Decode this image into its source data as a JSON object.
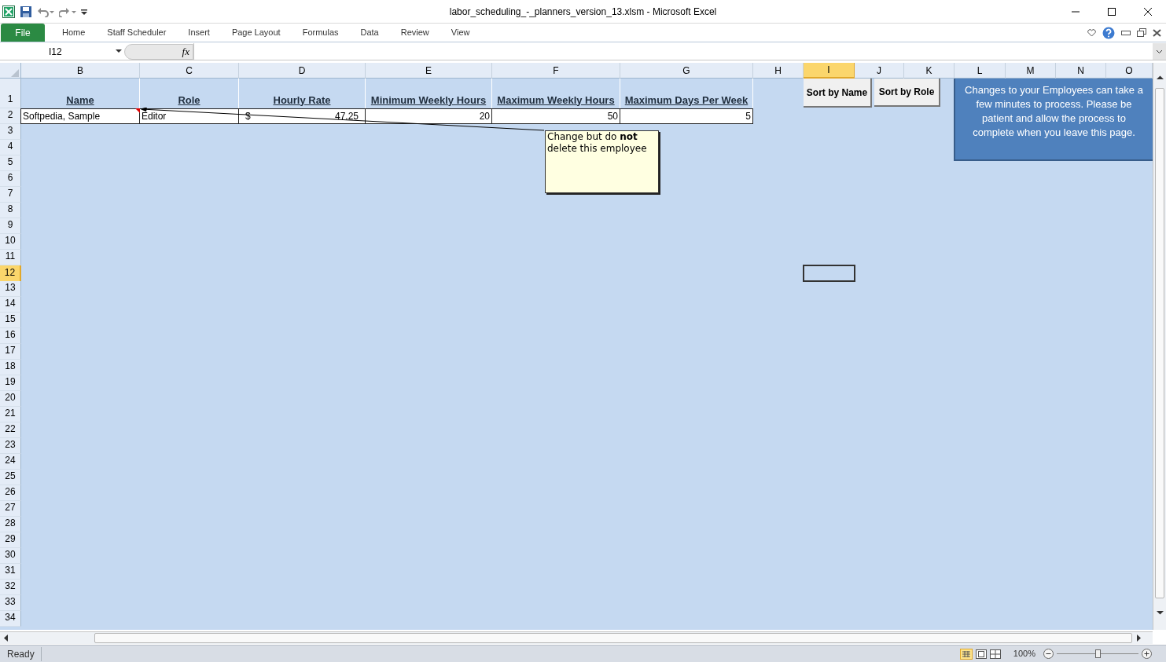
{
  "window": {
    "title": "labor_scheduling_-_planners_version_13.xlsm  -  Microsoft Excel"
  },
  "ribbon_tabs": [
    {
      "label": "File",
      "kind": "file",
      "selected": false
    },
    {
      "label": "Home",
      "kind": "tab",
      "selected": false
    },
    {
      "label": "Staff Scheduler",
      "kind": "tab",
      "selected": false
    },
    {
      "label": "Insert",
      "kind": "tab",
      "selected": false
    },
    {
      "label": "Page Layout",
      "kind": "tab",
      "selected": false
    },
    {
      "label": "Formulas",
      "kind": "tab",
      "selected": false
    },
    {
      "label": "Data",
      "kind": "tab",
      "selected": false
    },
    {
      "label": "Review",
      "kind": "tab",
      "selected": false
    },
    {
      "label": "View",
      "kind": "tab",
      "selected": false
    }
  ],
  "name_box": "I12",
  "function_button": "fx",
  "columns": [
    {
      "label": "B",
      "selected": false
    },
    {
      "label": "C",
      "selected": false
    },
    {
      "label": "D",
      "selected": false
    },
    {
      "label": "E",
      "selected": false
    },
    {
      "label": "F",
      "selected": false
    },
    {
      "label": "G",
      "selected": false
    },
    {
      "label": "H",
      "selected": false
    },
    {
      "label": "I",
      "selected": true
    },
    {
      "label": "J",
      "selected": false
    },
    {
      "label": "K",
      "selected": false
    },
    {
      "label": "L",
      "selected": false
    },
    {
      "label": "M",
      "selected": false
    },
    {
      "label": "N",
      "selected": false
    },
    {
      "label": "O",
      "selected": false
    }
  ],
  "rows": [
    {
      "label": "1",
      "selected": false
    },
    {
      "label": "2",
      "selected": false
    },
    {
      "label": "3",
      "selected": false
    },
    {
      "label": "4",
      "selected": false
    },
    {
      "label": "5",
      "selected": false
    },
    {
      "label": "6",
      "selected": false
    },
    {
      "label": "7",
      "selected": false
    },
    {
      "label": "8",
      "selected": false
    },
    {
      "label": "9",
      "selected": false
    },
    {
      "label": "10",
      "selected": false
    },
    {
      "label": "11",
      "selected": false
    },
    {
      "label": "12",
      "selected": true
    },
    {
      "label": "13",
      "selected": false
    },
    {
      "label": "14",
      "selected": false
    },
    {
      "label": "15",
      "selected": false
    },
    {
      "label": "16",
      "selected": false
    },
    {
      "label": "17",
      "selected": false
    },
    {
      "label": "18",
      "selected": false
    },
    {
      "label": "19",
      "selected": false
    },
    {
      "label": "20",
      "selected": false
    },
    {
      "label": "21",
      "selected": false
    },
    {
      "label": "22",
      "selected": false
    },
    {
      "label": "23",
      "selected": false
    },
    {
      "label": "24",
      "selected": false
    },
    {
      "label": "25",
      "selected": false
    },
    {
      "label": "26",
      "selected": false
    },
    {
      "label": "27",
      "selected": false
    },
    {
      "label": "28",
      "selected": false
    },
    {
      "label": "29",
      "selected": false
    },
    {
      "label": "30",
      "selected": false
    },
    {
      "label": "31",
      "selected": false
    },
    {
      "label": "32",
      "selected": false
    },
    {
      "label": "33",
      "selected": false
    },
    {
      "label": "34",
      "selected": false
    }
  ],
  "table": {
    "headers": [
      "Name",
      "Role",
      "Hourly Rate",
      "Minimum Weekly Hours",
      "Maximum Weekly Hours",
      "Maximum Days Per Week"
    ],
    "rows": [
      {
        "name": "Softpedia, Sample",
        "role": "Editor",
        "currency": "$",
        "hourly_rate": "47.25",
        "min_hours": "20",
        "max_hours": "50",
        "max_days": "5",
        "has_comment": true
      }
    ]
  },
  "buttons": [
    "Sort by Name",
    "Sort by Role"
  ],
  "note_box": "Changes to your Employees can take a few minutes to process. Please be patient and allow the process to complete when you leave this page.",
  "comment": "Change but do **not** delete this employee",
  "status_bar": {
    "status": "Ready",
    "zoom": "100%",
    "zoom_slider": {
      "level": 0.5
    }
  }
}
